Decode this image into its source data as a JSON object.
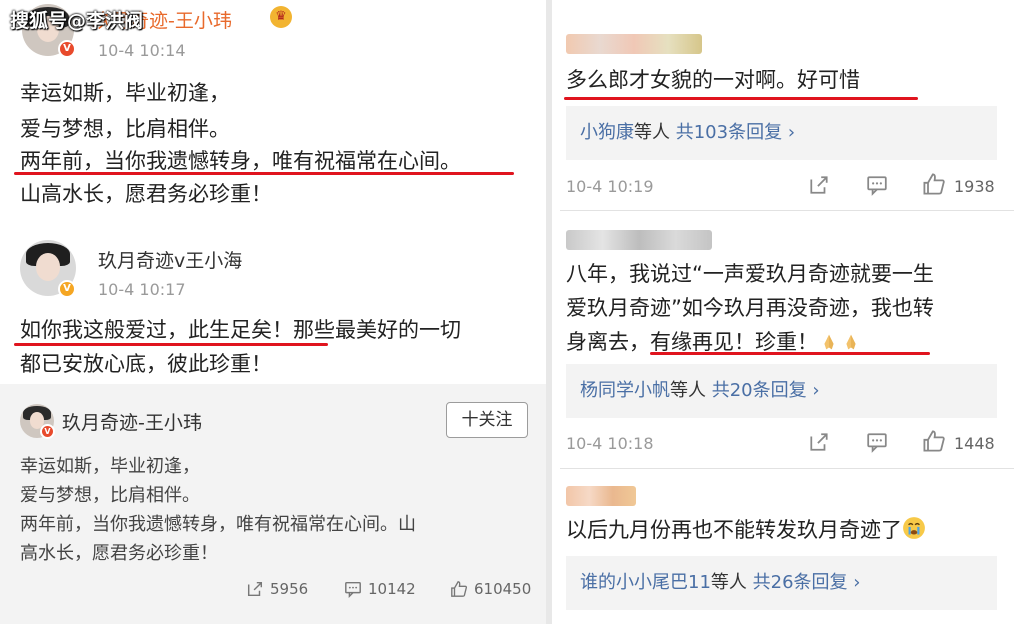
{
  "watermark": "搜狐号@李洪阀",
  "left": {
    "post1": {
      "author": "玖月奇迹-王小玮",
      "time": "10-4 10:14",
      "lines": [
        "幸运如斯，毕业初逢，",
        "爱与梦想，比肩相伴。",
        "两年前，当你我遗憾转身，唯有祝福常在心间。",
        "山高水长，愿君务必珍重！"
      ]
    },
    "post2": {
      "author": "玖月奇迹v王小海",
      "time": "10-4 10:17",
      "lines": [
        "如你我这般爱过，此生足矣！那些最美好的一切",
        "都已安放心底，彼此珍重！"
      ]
    },
    "repost": {
      "author": "玖月奇迹-王小玮",
      "follow_label": "十关注",
      "lines": [
        "幸运如斯，毕业初逢，",
        "爱与梦想，比肩相伴。",
        "两年前，当你我遗憾转身，唯有祝福常在心间。山",
        "高水长，愿君务必珍重！"
      ],
      "shares": "5956",
      "comments": "10142",
      "likes": "610450"
    }
  },
  "right": {
    "comment1": {
      "text": "多么郎才女貌的一对啊。好可惜",
      "reply_user": "小狗康",
      "reply_mid": "等人",
      "reply_count": "共103条回复",
      "time": "10-4 10:19",
      "likes": "1938"
    },
    "comment2": {
      "lines": [
        "八年，我说过“一声爱玖月奇迹就要一生",
        "爱玖月奇迹”如今玖月再没奇迹，我也转",
        "身离去，有缘再见！珍重！"
      ],
      "reply_user": "杨同学小帆",
      "reply_mid": "等人",
      "reply_count": "共20条回复",
      "time": "10-4 10:18",
      "likes": "1448"
    },
    "comment3": {
      "text": "以后九月份再也不能转发玖月奇迹了",
      "reply_user": "谁的小小尾巴11",
      "reply_mid": "等人",
      "reply_count": "共26条回复"
    }
  },
  "colors": {
    "underline": "#e0141e",
    "link": "#4a6fa5",
    "author_orange": "#e86a2c"
  },
  "icons": [
    "crown-icon",
    "verified-badge-icon",
    "share-icon",
    "comment-icon",
    "like-icon",
    "chevron-right-icon",
    "crying-emoji",
    "praying-hands-emoji"
  ]
}
